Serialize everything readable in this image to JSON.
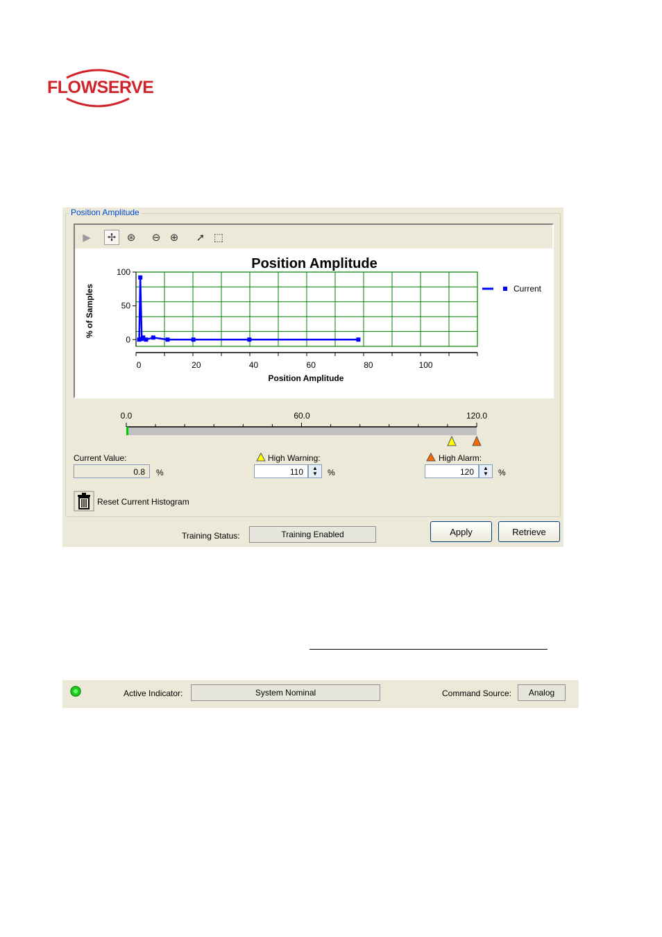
{
  "brand": {
    "name": "FLOWSERVE",
    "color": "#d2232a"
  },
  "panel": {
    "group_title": "Position Amplitude",
    "toolbar_icons": [
      "play-icon",
      "pan-icon",
      "zoom-axis-icon",
      "zoom-out-icon",
      "zoom-in-icon",
      "pointer-icon",
      "selection-icon"
    ],
    "range_slider": {
      "min_label": "0.0",
      "mid_label": "60.0",
      "max_label": "120.0",
      "min": 0,
      "max": 120,
      "current": 0.8,
      "warning": 110,
      "alarm": 120
    },
    "current_value": {
      "label": "Current Value:",
      "value": "0.8",
      "unit": "%"
    },
    "high_warning": {
      "label": "High Warning:",
      "value": "110",
      "unit": "%",
      "color": "#ffff00"
    },
    "high_alarm": {
      "label": "High Alarm:",
      "value": "120",
      "unit": "%",
      "color": "#ff6600"
    },
    "reset_label": "Reset Current Histogram",
    "training_status_label": "Training Status:",
    "training_status_value": "Training Enabled",
    "apply_label": "Apply",
    "retrieve_label": "Retrieve"
  },
  "chart_data": {
    "type": "line",
    "title": "Position Amplitude",
    "xlabel": "Position Amplitude",
    "ylabel": "% of Samples",
    "xlim": [
      -1,
      118
    ],
    "ylim": [
      -10,
      100
    ],
    "xticks": [
      0,
      20,
      40,
      60,
      80,
      100
    ],
    "yticks": [
      0,
      50,
      100
    ],
    "grid": true,
    "grid_color": "#008000",
    "legend_position": "right",
    "series": [
      {
        "name": "Current",
        "color": "#0000ff",
        "x": [
          0.1,
          0.5,
          1,
          1.5,
          2.5,
          5,
          10,
          19,
          38.5,
          76.5
        ],
        "y": [
          0,
          92,
          1,
          3,
          0,
          3,
          0,
          0,
          0,
          0
        ]
      }
    ]
  },
  "status_bar": {
    "indicator_color": "#22cc22",
    "active_indicator_label": "Active Indicator:",
    "active_indicator_value": "System Nominal",
    "command_source_label": "Command Source:",
    "command_source_value": "Analog"
  }
}
